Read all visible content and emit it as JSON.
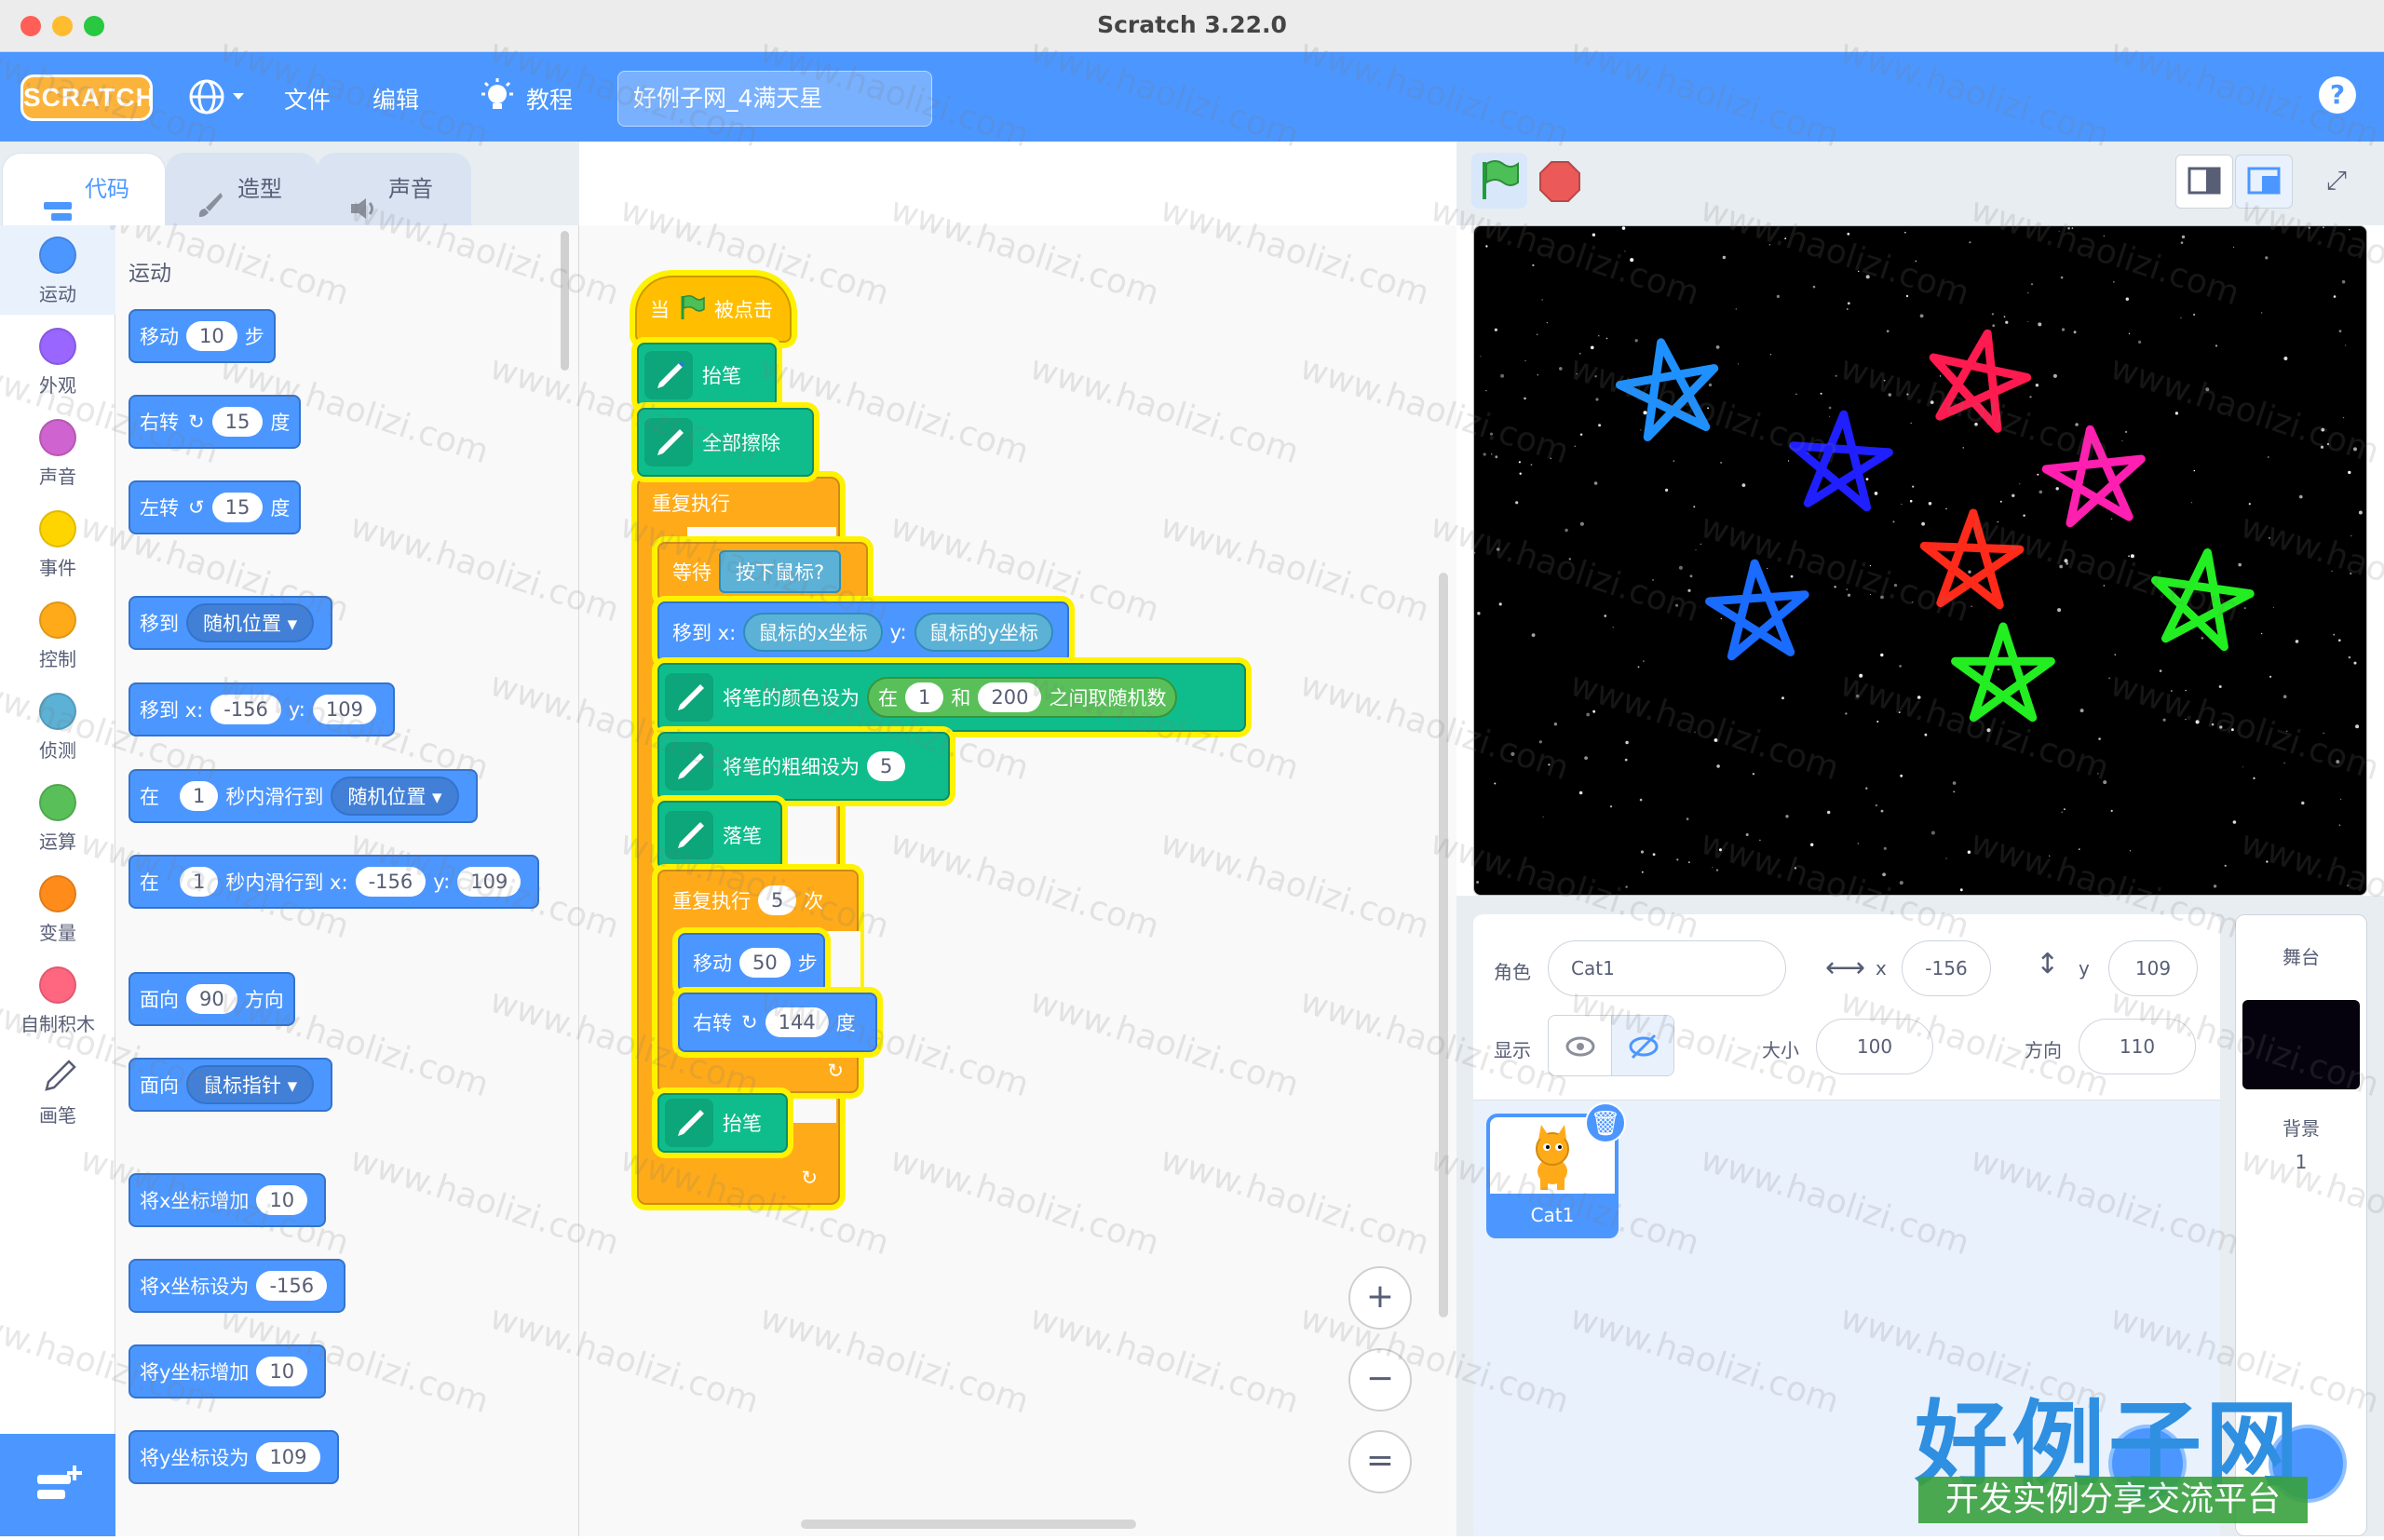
{
  "window": {
    "title": "Scratch 3.22.0"
  },
  "menu": {
    "logo": "SCRATCH",
    "file": "文件",
    "edit": "编辑",
    "tutorials": "教程",
    "project_title": "好例子网_4满天星",
    "help": "?"
  },
  "tabs": {
    "code": "代码",
    "costumes": "造型",
    "sounds": "声音"
  },
  "categories": [
    {
      "label": "运动",
      "color": "#4c97ff"
    },
    {
      "label": "外观",
      "color": "#9966ff"
    },
    {
      "label": "声音",
      "color": "#cf63cf"
    },
    {
      "label": "事件",
      "color": "#ffd500"
    },
    {
      "label": "控制",
      "color": "#ffab19"
    },
    {
      "label": "侦测",
      "color": "#5cb1d6"
    },
    {
      "label": "运算",
      "color": "#59c059"
    },
    {
      "label": "变量",
      "color": "#ff8c1a"
    },
    {
      "label": "自制积木",
      "color": "#ff6680"
    },
    {
      "label": "画笔",
      "color": "#0fbd8c"
    }
  ],
  "palette": {
    "heading": "运动",
    "move": {
      "a": "移动",
      "v": "10",
      "b": "步"
    },
    "turn_right": {
      "a": "右转",
      "v": "15",
      "b": "度"
    },
    "turn_left": {
      "a": "左转",
      "v": "15",
      "b": "度"
    },
    "goto": {
      "a": "移到",
      "d": "随机位置"
    },
    "goto_xy": {
      "a": "移到 x:",
      "x": "-156",
      "b": "y:",
      "y": "109"
    },
    "glide": {
      "a": "在",
      "v": "1",
      "b": "秒内滑行到",
      "d": "随机位置"
    },
    "glide_xy": {
      "a": "在",
      "v": "1",
      "b": "秒内滑行到 x:",
      "x": "-156",
      "c": "y:",
      "y": "109"
    },
    "point_dir": {
      "a": "面向",
      "v": "90",
      "b": "方向"
    },
    "point_towards": {
      "a": "面向",
      "d": "鼠标指针"
    },
    "change_x": {
      "a": "将x坐标增加",
      "v": "10"
    },
    "set_x": {
      "a": "将x坐标设为",
      "v": "-156"
    },
    "change_y": {
      "a": "将y坐标增加",
      "v": "10"
    },
    "set_y": {
      "a": "将y坐标设为",
      "v": "109"
    }
  },
  "script": {
    "hat": {
      "a": "当",
      "b": "被点击"
    },
    "pen_up1": "抬笔",
    "clear": "全部擦除",
    "forever": "重复执行",
    "wait": {
      "a": "等待",
      "cond": "按下鼠标?"
    },
    "goto": {
      "a": "移到 x:",
      "x": "鼠标的x坐标",
      "b": "y:",
      "y": "鼠标的y坐标"
    },
    "set_color": {
      "a": "将笔的颜色设为",
      "b": "在",
      "v1": "1",
      "c": "和",
      "v2": "200",
      "d": "之间取随机数"
    },
    "set_size": {
      "a": "将笔的粗细设为",
      "v": "5"
    },
    "pen_down": "落笔",
    "repeat": {
      "a": "重复执行",
      "v": "5",
      "b": "次"
    },
    "move": {
      "a": "移动",
      "v": "50",
      "b": "步"
    },
    "turn": {
      "a": "右转",
      "v": "144",
      "b": "度"
    },
    "pen_up2": "抬笔",
    "loop_arrow": "↻"
  },
  "zoom": {
    "in": "+",
    "out": "−",
    "reset": "="
  },
  "sprite_info": {
    "sprite_label": "角色",
    "sprite_name": "Cat1",
    "x_label": "x",
    "x": "-156",
    "y_label": "y",
    "y": "109",
    "show_label": "显示",
    "size_label": "大小",
    "size": "100",
    "direction_label": "方向",
    "direction": "110"
  },
  "sprites": [
    {
      "name": "Cat1"
    }
  ],
  "stage_panel": {
    "title": "舞台",
    "backdrops_label": "背景",
    "backdrops_count": "1"
  },
  "watermark": {
    "title": "好例子网",
    "subtitle": "开发实例分享交流平台",
    "url": "www.haolizi.com"
  },
  "stars": [
    {
      "color": "#1e90ff"
    },
    {
      "color": "#ff1a4f"
    },
    {
      "color": "#1f1fff"
    },
    {
      "color": "#ff1fb0"
    },
    {
      "color": "#ff2a1a"
    },
    {
      "color": "#1a6bff"
    },
    {
      "color": "#22ee22"
    },
    {
      "color": "#22ee22"
    }
  ]
}
